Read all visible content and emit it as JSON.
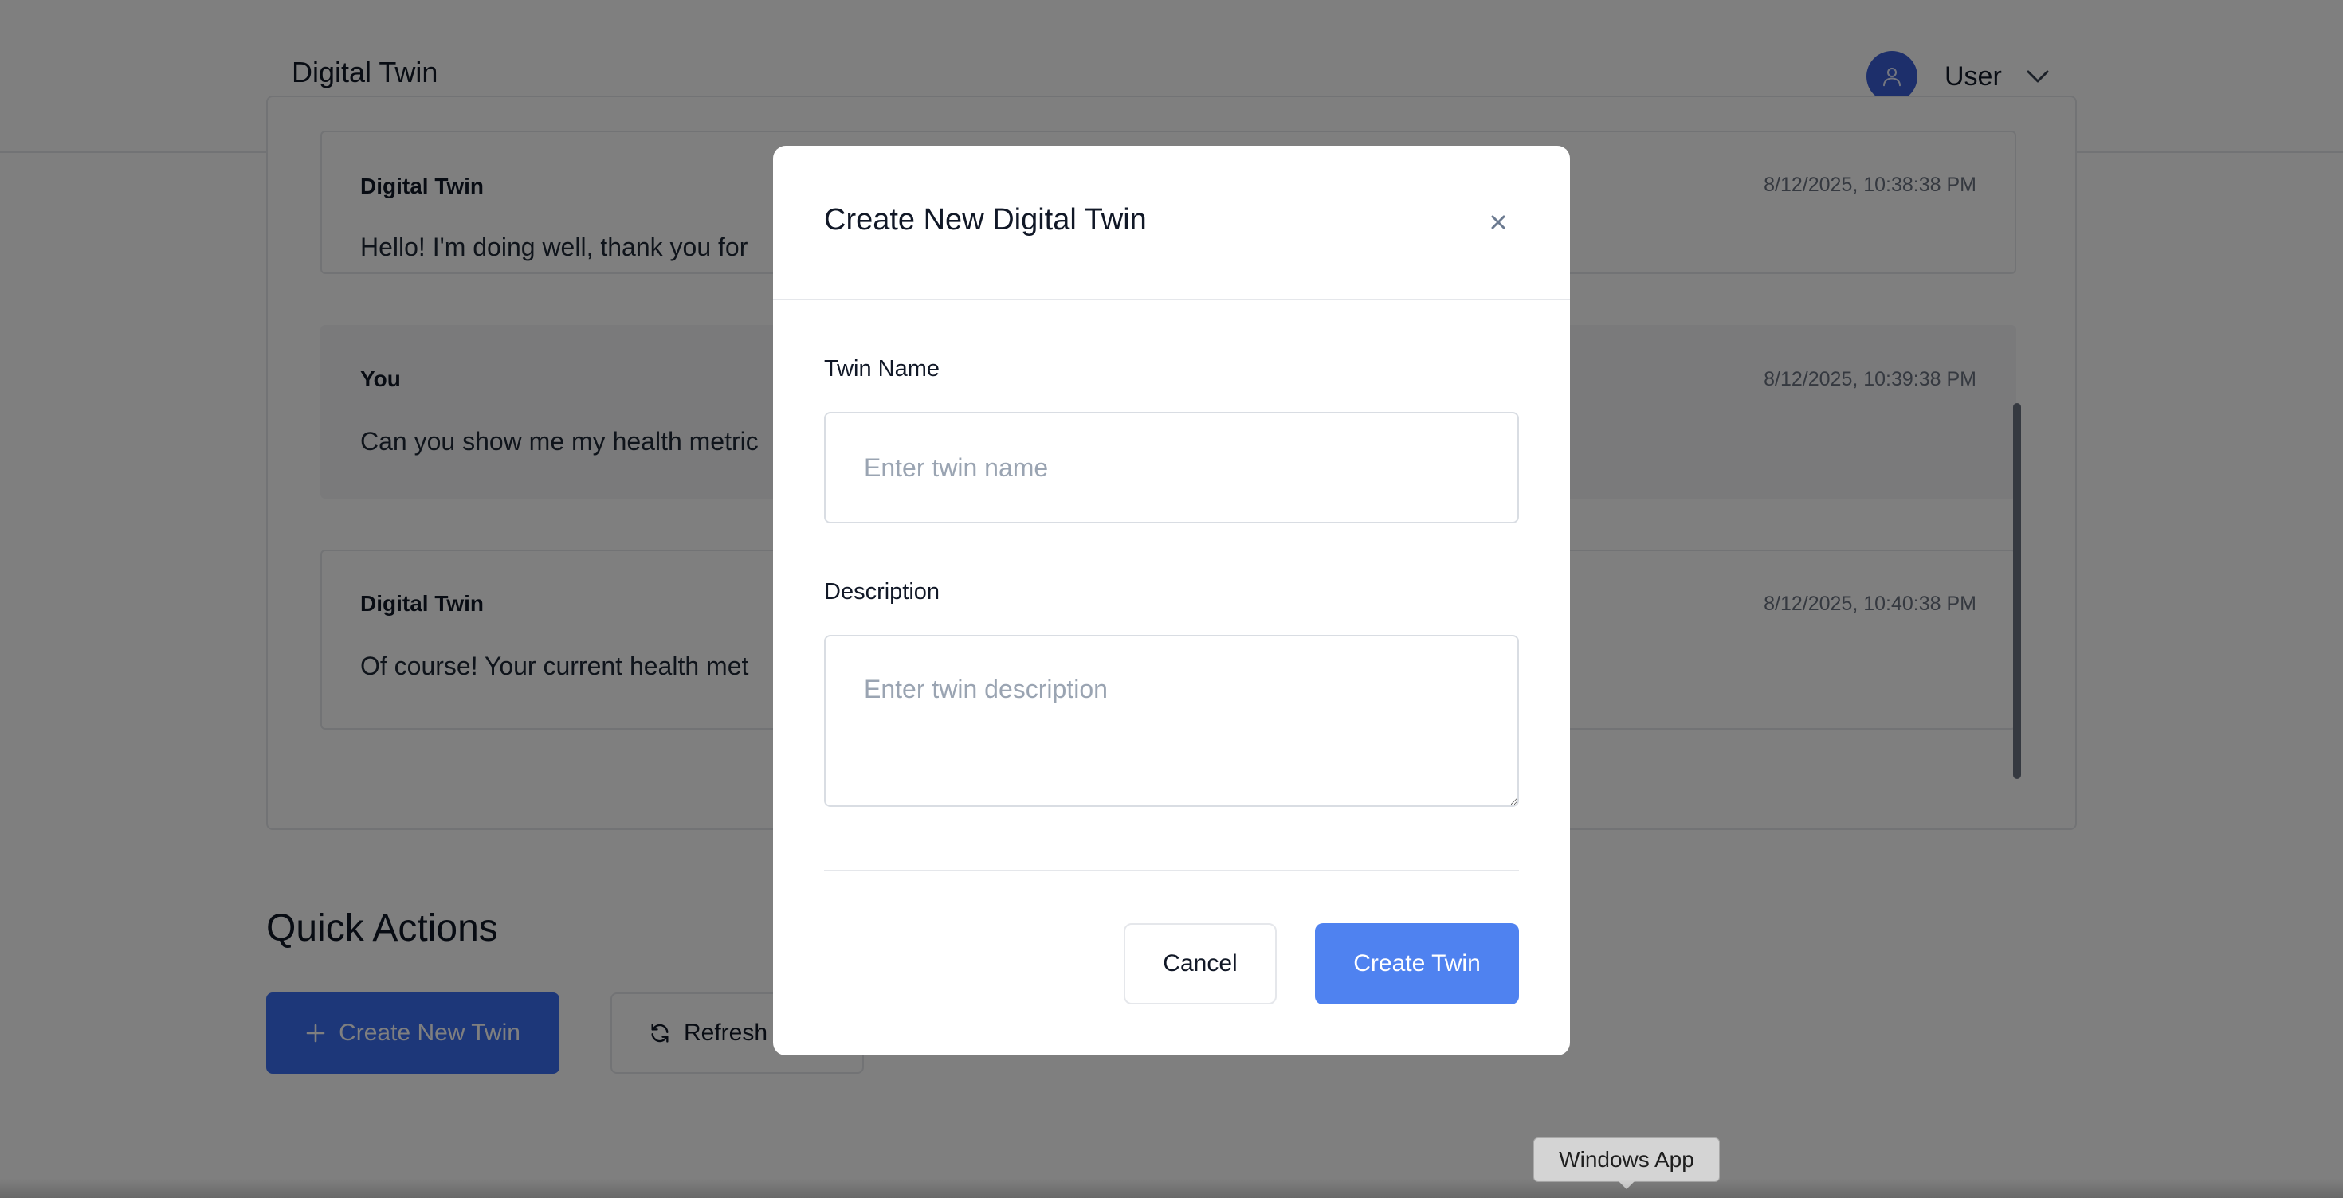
{
  "header": {
    "brand": "Digital Twin",
    "user_name": "User",
    "icons": {
      "avatar": "user-icon",
      "menu": "chevron-down-icon"
    }
  },
  "chat": {
    "messages": [
      {
        "author": "Digital Twin",
        "timestamp": "8/12/2025, 10:38:38 PM",
        "text": "Hello! I'm doing well, thank you for"
      },
      {
        "author": "You",
        "timestamp": "8/12/2025, 10:39:38 PM",
        "text": "Can you show me my health metric"
      },
      {
        "author": "Digital Twin",
        "timestamp": "8/12/2025, 10:40:38 PM",
        "text": "Of course! Your current health met"
      }
    ]
  },
  "quick_actions": {
    "title": "Quick Actions",
    "create_new_label": "Create New Twin",
    "refresh_label": "Refresh",
    "icons": {
      "create": "plus-icon",
      "refresh": "refresh-icon"
    }
  },
  "modal": {
    "title": "Create New Digital Twin",
    "close_icon": "close-icon",
    "name_label": "Twin Name",
    "name_placeholder": "Enter twin name",
    "name_value": "",
    "description_label": "Description",
    "description_placeholder": "Enter twin description",
    "description_value": "",
    "cancel_label": "Cancel",
    "create_label": "Create Twin"
  },
  "tooltip": {
    "text": "Windows App"
  },
  "colors": {
    "primary": "#4f82f0",
    "primary_dim": "#3b6ff2",
    "avatar": "#3b5fd6",
    "overlay": "rgba(0,0,0,0.5)"
  }
}
